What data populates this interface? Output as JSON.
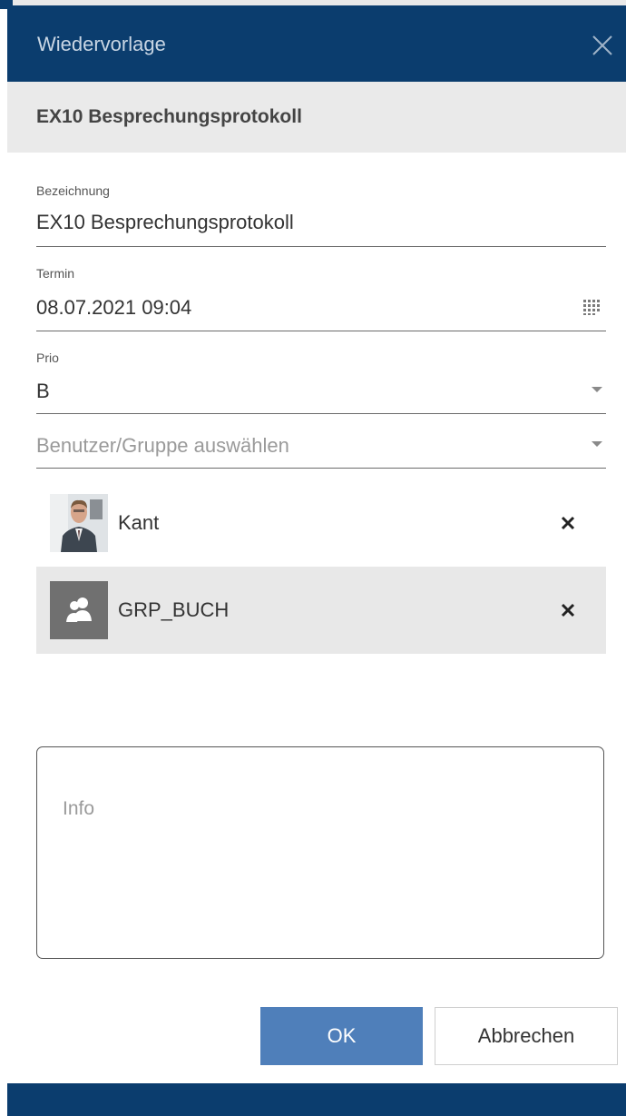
{
  "dialog": {
    "title": "Wiedervorlage",
    "subtitle": "EX10 Besprechungsprotokoll"
  },
  "form": {
    "bezeichnung": {
      "label": "Bezeichnung",
      "value": "EX10 Besprechungsprotokoll"
    },
    "termin": {
      "label": "Termin",
      "value": "08.07.2021 09:04"
    },
    "prio": {
      "label": "Prio",
      "value": "B"
    },
    "recipient_select": {
      "placeholder": "Benutzer/Gruppe auswählen"
    }
  },
  "assignees": [
    {
      "name": "Kant",
      "type": "user",
      "selected": false
    },
    {
      "name": "GRP_BUCH",
      "type": "group",
      "selected": true
    }
  ],
  "info": {
    "placeholder": "Info"
  },
  "buttons": {
    "ok": "OK",
    "cancel": "Abbrechen"
  },
  "colors": {
    "header": "#0b3d6e",
    "subheader": "#eaeaea",
    "primary_button": "#4f7fba",
    "selected_row": "#e8e8e8"
  },
  "icons": {
    "close": "close-icon",
    "calendar": "calendar-icon",
    "dropdown": "chevron-down-icon",
    "remove": "remove-icon",
    "group": "group-icon"
  }
}
